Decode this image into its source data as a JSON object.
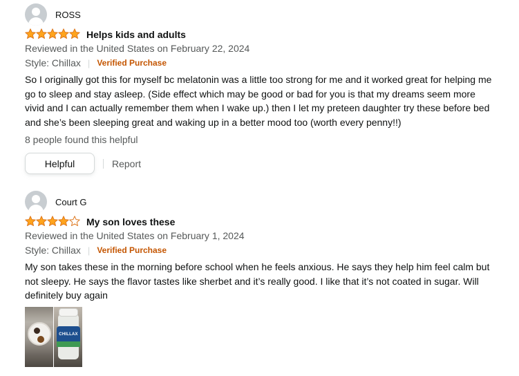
{
  "reviews": [
    {
      "profile_name": "ROSS",
      "rating": 5,
      "title": "Helps kids and adults",
      "date": "Reviewed in the United States on February 22, 2024",
      "style": "Style: Chillax",
      "verified": "Verified Purchase",
      "body": "So I originally got this for myself bc melatonin was a little too strong for me and it worked great for helping me go to sleep and stay asleep. (Side effect which may be good or bad for you is that my dreams seem more vivid and I can actually remember them when I wake up.) then I let my preteen daughter try these before bed and she’s been sleeping great and waking up in a better mood too (worth every penny!!)",
      "helpful_count": "8 people found this helpful",
      "helpful_label": "Helpful",
      "report_label": "Report"
    },
    {
      "profile_name": "Court G",
      "rating": 4,
      "title": "My son loves these",
      "date": "Reviewed in the United States on February 1, 2024",
      "style": "Style: Chillax",
      "verified": "Verified Purchase",
      "body": "My son takes these in the morning before school when he feels anxious. He says they help him feel calm but not sleepy. He says the flavor tastes like sherbet and it’s really good. I like that it’s not coated in sugar. Will definitely buy again",
      "images": [
        "gummies-in-bowl",
        "chillax-jar"
      ],
      "jar_label": "CHILLAX"
    }
  ],
  "colors": {
    "star_fill": "#FFA41C",
    "star_stroke": "#DE7921",
    "verified": "#C45500",
    "muted_text": "#565959"
  },
  "icons": {
    "avatar": "default-user-avatar-icon",
    "star": "star-icon"
  }
}
